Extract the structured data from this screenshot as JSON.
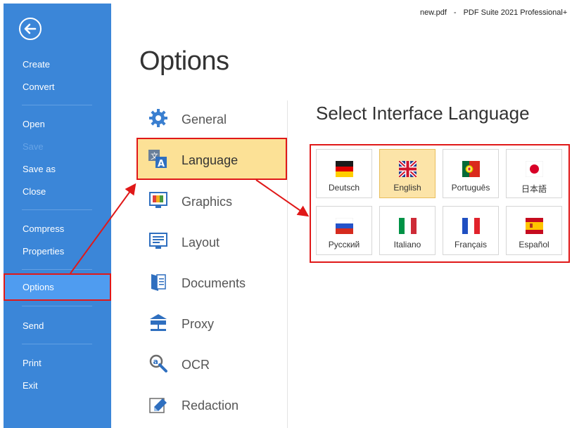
{
  "titlebar": {
    "file": "new.pdf",
    "separator": "-",
    "app": "PDF Suite 2021 Professional+"
  },
  "sidebar": {
    "items": [
      {
        "label": "Create",
        "disabled": false
      },
      {
        "label": "Convert",
        "disabled": false
      },
      {
        "label": "Open",
        "disabled": false
      },
      {
        "label": "Save",
        "disabled": true
      },
      {
        "label": "Save as",
        "disabled": false
      },
      {
        "label": "Close",
        "disabled": false
      },
      {
        "label": "Compress",
        "disabled": false
      },
      {
        "label": "Properties",
        "disabled": false
      },
      {
        "label": "Options",
        "selected": true
      },
      {
        "label": "Send",
        "disabled": false
      },
      {
        "label": "Print",
        "disabled": false
      },
      {
        "label": "Exit",
        "disabled": false
      }
    ]
  },
  "page": {
    "title": "Options"
  },
  "categories": [
    {
      "label": "General",
      "icon": "gear-icon"
    },
    {
      "label": "Language",
      "icon": "language-icon",
      "selected": true
    },
    {
      "label": "Graphics",
      "icon": "graphics-icon"
    },
    {
      "label": "Layout",
      "icon": "layout-icon"
    },
    {
      "label": "Documents",
      "icon": "documents-icon"
    },
    {
      "label": "Proxy",
      "icon": "proxy-icon"
    },
    {
      "label": "OCR",
      "icon": "ocr-icon"
    },
    {
      "label": "Redaction",
      "icon": "redaction-icon"
    }
  ],
  "language_panel": {
    "title": "Select Interface Language",
    "languages": [
      {
        "label": "Deutsch",
        "flag": "germany-flag-icon"
      },
      {
        "label": "English",
        "flag": "uk-flag-icon",
        "selected": true
      },
      {
        "label": "Português",
        "flag": "portugal-flag-icon"
      },
      {
        "label": "日本語",
        "flag": "japan-flag-icon"
      },
      {
        "label": "Русский",
        "flag": "russia-flag-icon"
      },
      {
        "label": "Italiano",
        "flag": "italy-flag-icon"
      },
      {
        "label": "Français",
        "flag": "france-flag-icon"
      },
      {
        "label": "Español",
        "flag": "spain-flag-icon"
      }
    ]
  },
  "colors": {
    "sidebar": "#3b86d8",
    "sidebar_selected": "#4f9cf0",
    "highlight": "#fce196",
    "annotation": "#e01818"
  }
}
